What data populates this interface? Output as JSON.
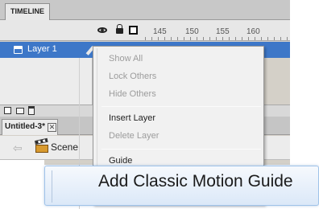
{
  "panel": {
    "tab_label": "TIMELINE"
  },
  "timeline": {
    "frame_numbers": [
      "145",
      "150",
      "155",
      "160"
    ],
    "layer_name": "Layer 1"
  },
  "document": {
    "tab_label": "Untitled-3*",
    "close_glyph": "✕",
    "back_glyph": "⇦",
    "scene_label": "Scene"
  },
  "context_menu": {
    "items": [
      {
        "label": "Show All",
        "enabled": false
      },
      {
        "label": "Lock Others",
        "enabled": false
      },
      {
        "label": "Hide Others",
        "enabled": false
      },
      {
        "label": "Insert Layer",
        "enabled": true
      },
      {
        "label": "Delete Layer",
        "enabled": false
      },
      {
        "label": "Guide",
        "enabled": true
      }
    ],
    "highlighted_item": "Add Classic Motion Guide"
  },
  "colors": {
    "selected_layer": "#3d77c8",
    "menu_background": "#f1f1f1",
    "highlight": "#dbe8f8"
  },
  "icons": [
    "eye-icon",
    "lock-icon",
    "outline-icon",
    "layer-icon",
    "pencil-icon",
    "new-layer-icon",
    "folder-icon",
    "trash-icon",
    "close-icon",
    "back-arrow-icon",
    "scene-icon"
  ]
}
